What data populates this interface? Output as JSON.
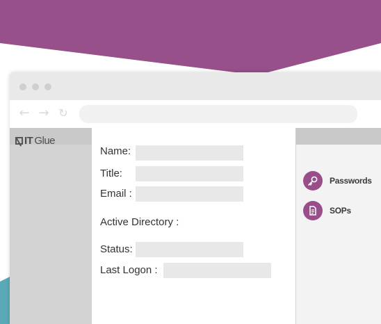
{
  "colors": {
    "banner": "#97508a",
    "accent_purple": "#984e8a",
    "teal": "#5aa9b6",
    "panel_gray": "#d2d2d2",
    "field_gray": "#e8e8e8"
  },
  "browser": {
    "nav_icons": [
      "back-arrow-icon",
      "forward-arrow-icon",
      "reload-icon"
    ],
    "address_placeholder": ""
  },
  "app": {
    "logo_bold": "IT",
    "logo_text": "Glue"
  },
  "form": {
    "fields": [
      {
        "label": "Name:",
        "value": ""
      },
      {
        "label": "Title:",
        "value": ""
      },
      {
        "label": "Email :",
        "value": ""
      },
      {
        "label": "Active Directory :"
      },
      {
        "label": "Status:",
        "value": ""
      },
      {
        "label": "Last Logon :",
        "value": ""
      }
    ]
  },
  "sidebar": {
    "items": [
      {
        "label": "Passwords",
        "icon": "key-icon"
      },
      {
        "label": "SOPs",
        "icon": "document-icon"
      }
    ]
  }
}
